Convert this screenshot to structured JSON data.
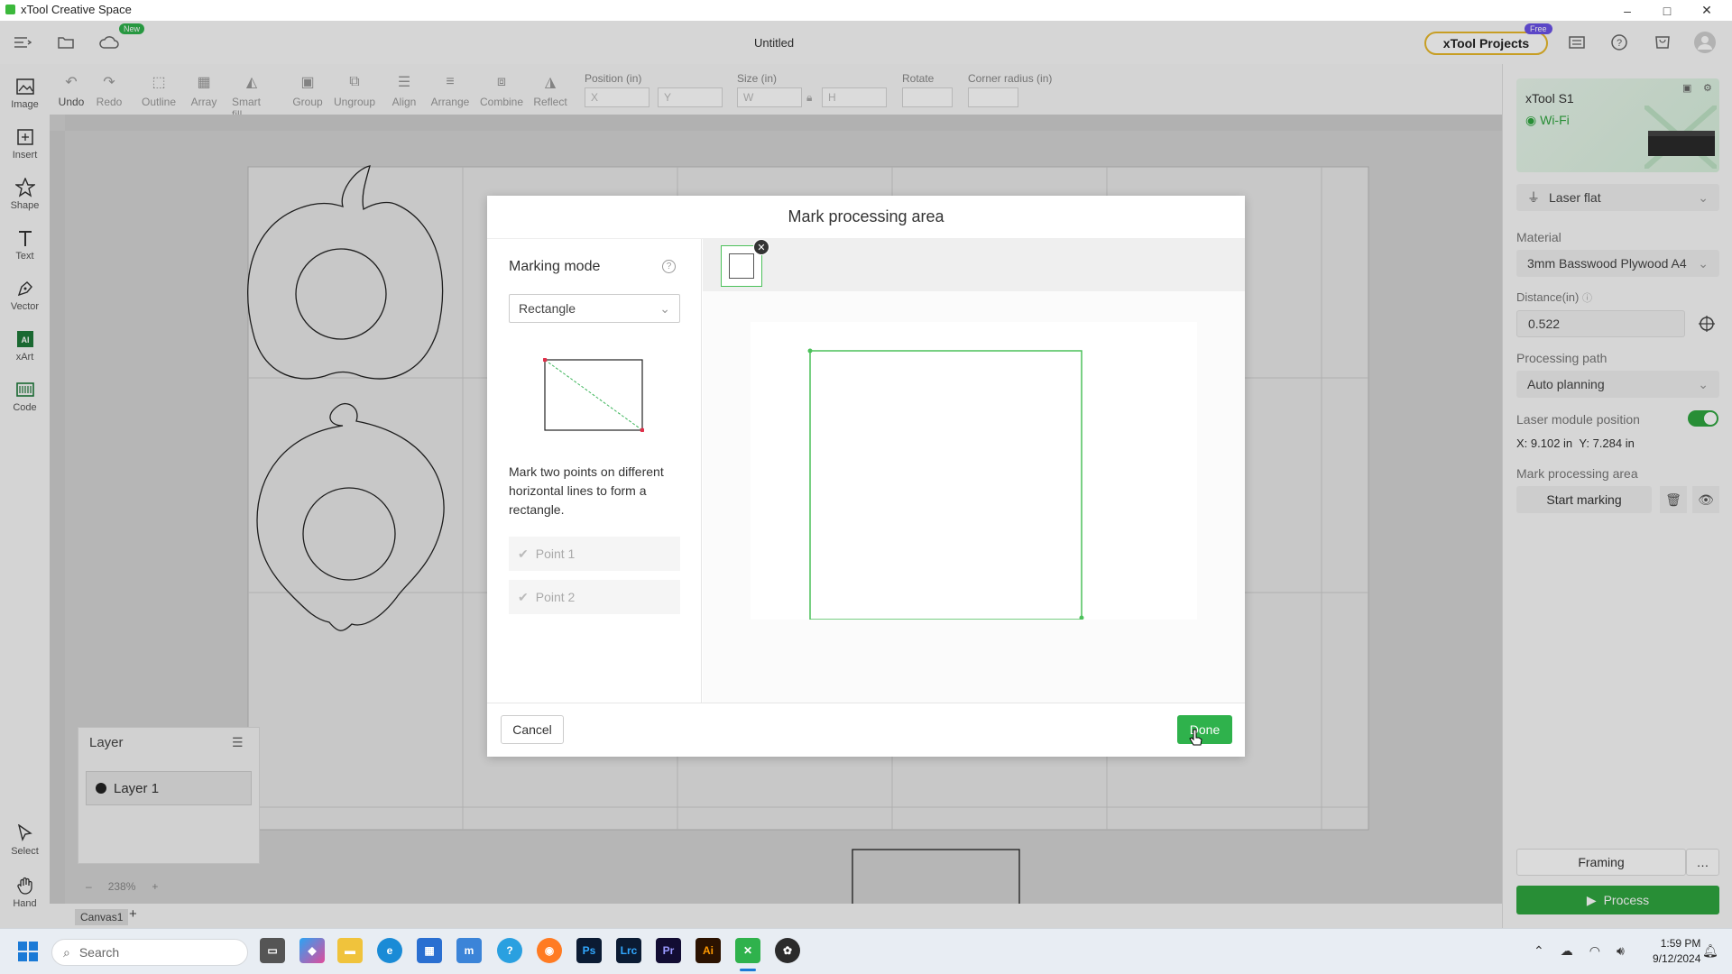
{
  "app": {
    "title": "xTool Creative Space",
    "doc_title": "Untitled",
    "new_badge": "New",
    "projects_label": "xTool Projects",
    "free_badge": "Free"
  },
  "window_controls": {
    "minimize": "–",
    "maximize": "□",
    "close": "✕"
  },
  "toolbar": {
    "buttons": [
      "Undo",
      "Redo",
      "Outline",
      "Array",
      "Smart fill",
      "Group",
      "Ungroup",
      "Align",
      "Arrange",
      "Combine",
      "Reflect"
    ],
    "position_label": "Position (in)",
    "x_placeholder": "X",
    "y_placeholder": "Y",
    "size_label": "Size (in)",
    "w_placeholder": "W",
    "h_placeholder": "H",
    "rotate_label": "Rotate",
    "corner_label": "Corner radius (in)"
  },
  "left_tools": [
    "Image",
    "Insert",
    "Shape",
    "Text",
    "Vector",
    "xArt",
    "Code"
  ],
  "left_bottom_tools": [
    "Select",
    "Hand"
  ],
  "layer_panel": {
    "title": "Layer",
    "layers": [
      "Layer 1"
    ]
  },
  "zoom": {
    "minus": "–",
    "value": "238%",
    "plus": "+"
  },
  "canvas_tabs": {
    "tab": "Canvas1",
    "add": "+"
  },
  "right_panel": {
    "device_name": "xTool S1",
    "device_conn": "Wi-Fi",
    "mode": "Laser flat",
    "material_label": "Material",
    "material_value": "3mm Basswood Plywood A4",
    "distance_label": "Distance(in)",
    "distance_value": "0.522",
    "path_label": "Processing path",
    "path_value": "Auto planning",
    "laser_pos_label": "Laser module position",
    "laser_pos_x": "X: 9.102 in",
    "laser_pos_y": "Y: 7.284 in",
    "mark_area_label": "Mark processing area",
    "start_marking": "Start marking",
    "framing": "Framing",
    "process": "Process",
    "more": "…"
  },
  "dialog": {
    "title": "Mark processing area",
    "marking_mode_label": "Marking mode",
    "mode_value": "Rectangle",
    "instructions": "Mark two points on different horizontal lines to form a rectangle.",
    "point1": "Point 1",
    "point2": "Point 2",
    "cancel": "Cancel",
    "done": "Done"
  },
  "taskbar": {
    "search_placeholder": "Search",
    "time": "1:59 PM",
    "date": "9/12/2024",
    "apps": [
      "Ps",
      "Lrc",
      "Pr",
      "Ai"
    ]
  },
  "colors": {
    "accent": "#2fb24c",
    "marking_green": "#4cc15a",
    "process_bg": "#2fa63f",
    "projects_border": "#e8b92a"
  }
}
